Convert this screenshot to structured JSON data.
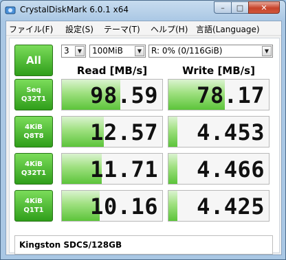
{
  "window": {
    "title": "CrystalDiskMark 6.0.1 x64",
    "close_glyph": "✕",
    "max_glyph": "□",
    "min_glyph": "–"
  },
  "menu": [
    {
      "label": "ファイル(F)"
    },
    {
      "label": "設定(S)"
    },
    {
      "label": "テーマ(T)"
    },
    {
      "label": "ヘルプ(H)"
    },
    {
      "label": "言語(Language)"
    }
  ],
  "controls": {
    "all_label": "All",
    "count_value": "3",
    "size_value": "100MiB",
    "drive_value": "R: 0% (0/116GiB)"
  },
  "headers": {
    "read": "Read [MB/s]",
    "write": "Write [MB/s]"
  },
  "rows": [
    {
      "line1": "Seq",
      "line2": "Q32T1",
      "read": "98.59",
      "write": "78.17",
      "read_fill": 0.58,
      "write_fill": 0.56
    },
    {
      "line1": "4KiB",
      "line2": "Q8T8",
      "read": "12.57",
      "write": "4.453",
      "read_fill": 0.42,
      "write_fill": 0.09
    },
    {
      "line1": "4KiB",
      "line2": "Q32T1",
      "read": "11.71",
      "write": "4.466",
      "read_fill": 0.4,
      "write_fill": 0.09
    },
    {
      "line1": "4KiB",
      "line2": "Q1T1",
      "read": "10.16",
      "write": "4.425",
      "read_fill": 0.38,
      "write_fill": 0.09
    }
  ],
  "comment": "Kingston SDCS/128GB",
  "colors": {
    "accent_green": "#2f9e1a",
    "bar_green": "#5cc43a",
    "close_red": "#c7432a"
  }
}
